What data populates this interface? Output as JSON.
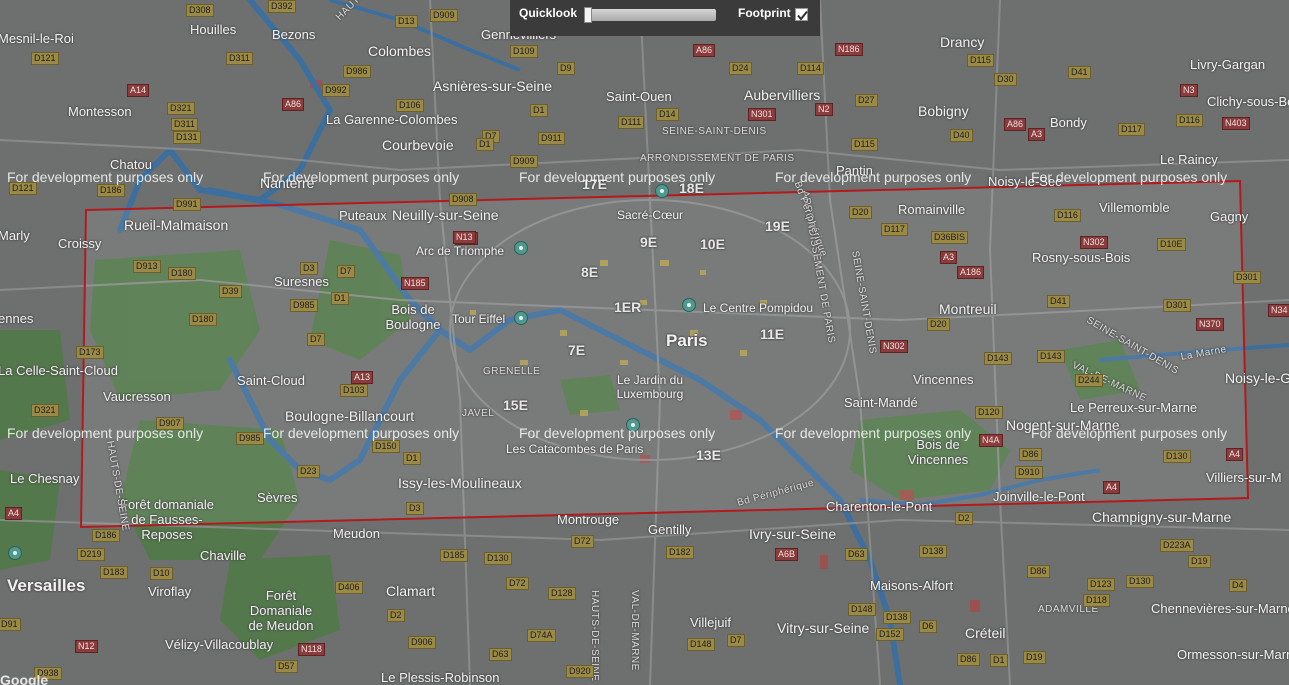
{
  "controls": {
    "quicklook_label": "Quicklook",
    "quicklook_value": 0,
    "footprint_label": "Footprint",
    "footprint_checked": true
  },
  "watermark": "For development purposes only",
  "cities": [
    {
      "t": "Mesnil-le-Roi"
    },
    {
      "t": "Houilles"
    },
    {
      "t": "Bezons"
    },
    {
      "t": "Colombes"
    },
    {
      "t": "Gennevilliers"
    },
    {
      "t": "Asnières-sur-Seine"
    },
    {
      "t": "Saint-Ouen"
    },
    {
      "t": "Aubervilliers"
    },
    {
      "t": "Drancy"
    },
    {
      "t": "Livry-Gargan"
    },
    {
      "t": "Clichy-sous-Bois"
    },
    {
      "t": "Montesson"
    },
    {
      "t": "La Garenne-Colombes"
    },
    {
      "t": "Bobigny"
    },
    {
      "t": "Bondy"
    },
    {
      "t": "Courbevoie"
    },
    {
      "t": "Chatou"
    },
    {
      "t": "Nanterre"
    },
    {
      "t": "Pantin"
    },
    {
      "t": "Le Raincy"
    },
    {
      "t": "Noisy-le-Sec"
    },
    {
      "t": "Rueil-Malmaison"
    },
    {
      "t": "Puteaux"
    },
    {
      "t": "Neuilly-sur-Seine"
    },
    {
      "t": "Romainville"
    },
    {
      "t": "Villemomble"
    },
    {
      "t": "Gagny"
    },
    {
      "t": "Croissy"
    },
    {
      "t": "Marly"
    },
    {
      "t": "Rosny-sous-Bois"
    },
    {
      "t": "Suresnes"
    },
    {
      "t": "Bois de Boulogne"
    },
    {
      "t": "Montreuil"
    },
    {
      "t": "ennes"
    },
    {
      "t": "Paris"
    },
    {
      "t": "La Celle-Saint-Cloud"
    },
    {
      "t": "Saint-Cloud"
    },
    {
      "t": "Vaucresson"
    },
    {
      "t": "Vincennes"
    },
    {
      "t": "Saint-Mandé"
    },
    {
      "t": "Noisy-le-G"
    },
    {
      "t": "Boulogne-Billancourt"
    },
    {
      "t": "Le Perreux-sur-Marne"
    },
    {
      "t": "Nogent-sur-Marne"
    },
    {
      "t": "Le Chesnay"
    },
    {
      "t": "Bois de Vincennes"
    },
    {
      "t": "Villiers-sur-M"
    },
    {
      "t": "Issy-les-Moulineaux"
    },
    {
      "t": "Sèvres"
    },
    {
      "t": "Forêt domaniale de Fausses-Reposes"
    },
    {
      "t": "Charenton-le-Pont"
    },
    {
      "t": "Joinville-le-Pont"
    },
    {
      "t": "Montrouge"
    },
    {
      "t": "Gentilly"
    },
    {
      "t": "Ivry-sur-Seine"
    },
    {
      "t": "Champigny-sur-Marne"
    },
    {
      "t": "Meudon"
    },
    {
      "t": "Chaville"
    },
    {
      "t": "Versailles"
    },
    {
      "t": "Viroflay"
    },
    {
      "t": "Clamart"
    },
    {
      "t": "Maisons-Alfort"
    },
    {
      "t": "Forêt Domaniale de Meudon"
    },
    {
      "t": "Villejuif"
    },
    {
      "t": "Vitry-sur-Seine"
    },
    {
      "t": "Créteil"
    },
    {
      "t": "Chennevières-sur-Marne"
    },
    {
      "t": "Vélizy-Villacoublay"
    },
    {
      "t": "Ormesson-sur-Marne"
    },
    {
      "t": "Le Plessis-Robinson"
    }
  ],
  "arrondissements": [
    "17E",
    "18E",
    "9E",
    "10E",
    "19E",
    "8E",
    "1ER",
    "11E",
    "7E",
    "15E",
    "13E"
  ],
  "districts": [
    "ARRONDISSEMENT DE PARIS",
    "SEINE-SAINT-DENIS",
    "ARRONDISSEMENT DE PARIS",
    "SEINE-SAINT-DENIS",
    "SEINE-SAINT-DENIS",
    "VAL-DE-MARNE",
    "HAUTS-DE-SEINE",
    "HAUTS-DE-SEINE",
    "GRENELLE",
    "JAVEL",
    "ADAMVILLE",
    "HAUTS-DE-SEINE",
    "VAL-DE-MARNE",
    "Bd Périphérique",
    "Bd Périphérique",
    "La Marne"
  ],
  "pois": [
    "Sacré-Cœur",
    "Arc de Triomphe",
    "Le Centre Pompidou",
    "Tour Eiffel",
    "Le Jardin du Luxembourg",
    "Les Catacombes de Paris"
  ],
  "roads": [
    "D308",
    "D392",
    "D13",
    "D909",
    "D311",
    "N13",
    "D121",
    "D986",
    "D992",
    "D109",
    "D9",
    "A86",
    "D24",
    "D114",
    "N186",
    "D115",
    "D30",
    "D41",
    "N3",
    "D106",
    "D1",
    "A14",
    "D321",
    "A86",
    "D311",
    "D131",
    "D7",
    "D911",
    "D111",
    "D14",
    "N301",
    "N2",
    "D27",
    "D40",
    "A86",
    "A3",
    "D117",
    "D116",
    "N403",
    "D186",
    "D1",
    "N302",
    "D121",
    "D909",
    "D115",
    "D20",
    "D117",
    "D116",
    "D991",
    "D908",
    "N13",
    "D36BIS",
    "A3",
    "D10E",
    "D913",
    "D180",
    "D3",
    "D7",
    "N185",
    "A186",
    "D301",
    "D39",
    "D985",
    "D1",
    "D41",
    "D301",
    "N34",
    "D180",
    "D7",
    "N370",
    "D173",
    "D20",
    "N302",
    "D143",
    "D143",
    "D244",
    "A13",
    "D103",
    "D321",
    "D907",
    "D120",
    "D985",
    "D150",
    "D1",
    "N4A",
    "D86",
    "D130",
    "A4",
    "D23",
    "D910",
    "A4",
    "D3",
    "D2",
    "A4",
    "D186",
    "D182",
    "A6B",
    "D223A",
    "D219",
    "D185",
    "D130",
    "D72",
    "D63",
    "D138",
    "D19",
    "D183",
    "D10",
    "D406",
    "D128",
    "D86",
    "D123",
    "D130",
    "D4",
    "D72",
    "D118",
    "D91",
    "D2",
    "N118",
    "D148",
    "D138",
    "D6",
    "D74A",
    "N12",
    "D906",
    "D63",
    "D148",
    "D7",
    "D152",
    "D57",
    "D920",
    "D938",
    "D86",
    "D1",
    "D19"
  ],
  "footprint": {
    "corners_note": "quadrilateral footprint"
  }
}
